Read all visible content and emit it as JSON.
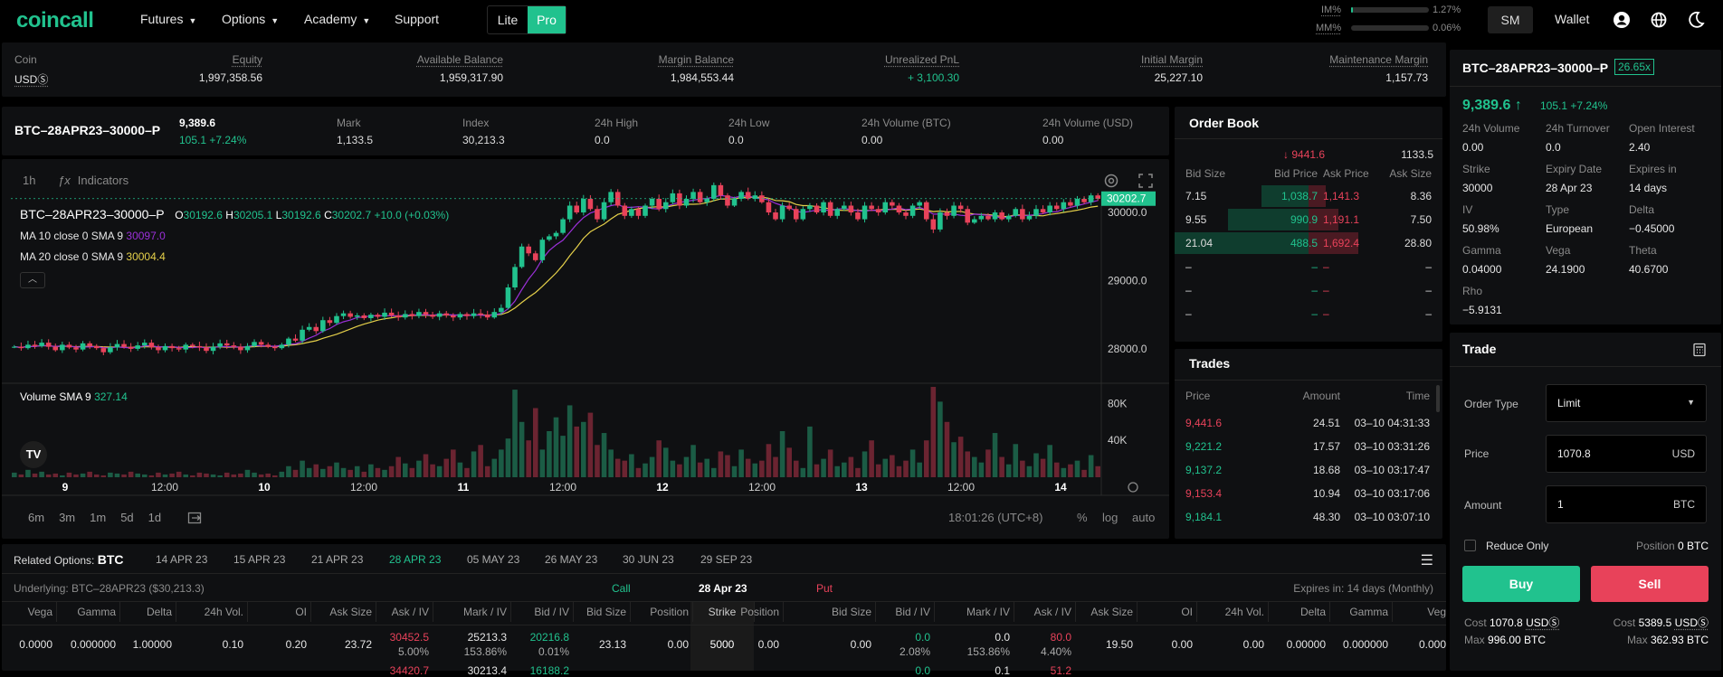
{
  "nav": {
    "logo": "coincall",
    "futures": "Futures",
    "options": "Options",
    "academy": "Academy",
    "support": "Support",
    "lite": "Lite",
    "pro": "Pro",
    "im_label": "IM%",
    "im_value": "1.27%",
    "mm_label": "MM%",
    "mm_value": "0.06%",
    "sm": "SM",
    "wallet": "Wallet"
  },
  "balance": {
    "coin_label": "Coin",
    "coin_value": "USDⓈ",
    "equity_label": "Equity",
    "equity": "1,997,358.56",
    "avail_label": "Available Balance",
    "avail": "1,959,317.90",
    "margin_label": "Margin Balance",
    "margin": "1,984,553.44",
    "upnl_label": "Unrealized PnL",
    "upnl": "+ 3,100.30",
    "im_label": "Initial Margin",
    "im": "25,227.10",
    "mm_label": "Maintenance Margin",
    "mm": "1,157.73"
  },
  "ticker": {
    "symbol": "BTC–28APR23–30000–P",
    "last": "9,389.6",
    "change": "105.1 +7.24%",
    "mark_label": "Mark",
    "mark": "1,133.5",
    "index_label": "Index",
    "index": "30,213.3",
    "high_label": "24h High",
    "high": "0.0",
    "low_label": "24h Low",
    "low": "0.0",
    "volb_label": "24h Volume (BTC)",
    "volb": "0.00",
    "volu_label": "24h Volume (USD)",
    "volu": "0.00"
  },
  "chart": {
    "interval": "1h",
    "indicators": "Indicators",
    "symbol": "BTC–28APR23–30000–P",
    "o": "30192.6",
    "h": "30205.1",
    "l": "30192.6",
    "c": "30202.7",
    "chg": "+10.0 (+0.03%)",
    "ma10": "MA 10 close 0 SMA 9",
    "ma10v": "30097.0",
    "ma20": "MA 20 close 0 SMA 9",
    "ma20v": "30004.4",
    "last_tag": "30202.7",
    "vol_label": "Volume SMA 9",
    "vol_value": "327.14",
    "time": "18:01:26 (UTC+8)",
    "pct": "%",
    "log": "log",
    "auto": "auto",
    "ranges": [
      "6m",
      "3m",
      "1m",
      "5d",
      "1d"
    ],
    "colors": {
      "up": "#21c28e",
      "down": "#e8425a",
      "ma10": "#9b30d9",
      "ma20": "#e5d04a"
    }
  },
  "chart_data": {
    "type": "candlestick",
    "yticks": [
      "30000.0",
      "29000.0",
      "28000.0"
    ],
    "vticks": [
      "80K",
      "40K"
    ],
    "xticks": [
      "9",
      "12:00",
      "10",
      "12:00",
      "11",
      "12:00",
      "12",
      "12:00",
      "13",
      "12:00",
      "14"
    ],
    "closes": [
      28030,
      28010,
      28060,
      28040,
      28090,
      28030,
      27980,
      28060,
      28020,
      27990,
      28080,
      28040,
      28010,
      27950,
      28020,
      28070,
      28030,
      28000,
      28050,
      28090,
      28020,
      27980,
      28040,
      28010,
      27990,
      28060,
      28040,
      28020,
      27970,
      28030,
      28080,
      28050,
      28030,
      27980,
      28040,
      28100,
      28060,
      28030,
      28010,
      28060,
      28150,
      28120,
      28280,
      28320,
      28260,
      28420,
      28380,
      28480,
      28520,
      28470,
      28490,
      28450,
      28500,
      28470,
      28530,
      28490,
      28460,
      28510,
      28480,
      28540,
      28500,
      28470,
      28520,
      28490,
      28460,
      28510,
      28480,
      28520,
      28500,
      28460,
      28540,
      28600,
      28900,
      29200,
      29500,
      29400,
      29300,
      29600,
      29650,
      29700,
      29900,
      30100,
      30000,
      30200,
      30050,
      29900,
      30150,
      30300,
      30100,
      29950,
      30050,
      29950,
      30100,
      30200,
      30050,
      30150,
      30280,
      30100,
      30200,
      30300,
      30150,
      30200,
      30400,
      30250,
      30100,
      30200,
      30300,
      30200,
      30250,
      30150,
      30000,
      29900,
      30100,
      30050,
      29900,
      30050,
      30100,
      30000,
      30150,
      29950,
      30050,
      30100,
      30000,
      29900,
      30100,
      30050,
      30000,
      30150,
      30100,
      30000,
      29950,
      30100,
      30150,
      29900,
      29750,
      30000,
      29950,
      30100,
      30050,
      29850,
      29900,
      29950,
      29900,
      30000,
      29900,
      29950,
      30050,
      29900,
      29950,
      30050,
      30000,
      30100,
      30050,
      30150,
      30100,
      30200,
      30150,
      30250,
      30200
    ],
    "volumes": [
      5,
      3,
      8,
      4,
      6,
      3,
      4,
      2,
      5,
      3,
      4,
      6,
      3,
      2,
      5,
      4,
      3,
      6,
      4,
      3,
      2,
      5,
      3,
      4,
      6,
      3,
      2,
      5,
      4,
      3,
      2,
      5,
      3,
      4,
      8,
      5,
      3,
      4,
      2,
      6,
      12,
      8,
      18,
      10,
      14,
      9,
      12,
      16,
      10,
      8,
      12,
      6,
      14,
      10,
      8,
      12,
      22,
      15,
      10,
      18,
      25,
      14,
      12,
      20,
      30,
      16,
      10,
      28,
      35,
      12,
      20,
      30,
      42,
      95,
      60,
      40,
      75,
      30,
      50,
      65,
      45,
      78,
      55,
      60,
      70,
      35,
      48,
      30,
      20,
      18,
      25,
      10,
      15,
      22,
      40,
      32,
      18,
      14,
      22,
      35,
      16,
      20,
      10,
      28,
      24,
      12,
      30,
      20,
      15,
      18,
      36,
      22,
      50,
      32,
      18,
      10,
      55,
      14,
      20,
      30,
      12,
      16,
      22,
      10,
      28,
      40,
      14,
      20,
      24,
      12,
      18,
      30,
      16,
      40,
      98,
      82,
      60,
      38,
      44,
      28,
      22,
      16,
      30,
      48,
      22,
      14,
      36,
      18,
      12,
      26,
      20,
      35,
      16,
      10,
      14,
      18,
      8,
      24,
      12,
      20,
      30,
      16
    ]
  },
  "orderbook": {
    "title": "Order Book",
    "last": "9441.6",
    "mark": "1133.5",
    "headers": [
      "Bid Size",
      "Bid Price",
      "Ask Price",
      "Ask Size"
    ],
    "rows": [
      {
        "bs": "7.15",
        "bp": "1,038.7",
        "ap": "1,141.3",
        "as": "8.36",
        "bd": 0.35
      },
      {
        "bs": "9.55",
        "bp": "990.9",
        "ap": "1,191.1",
        "as": "7.50",
        "bd": 0.6
      },
      {
        "bs": "21.04",
        "bp": "488.5",
        "ap": "1,692.4",
        "as": "28.80",
        "bd": 1.0
      },
      {
        "bs": "–",
        "bp": "–",
        "ap": "–",
        "as": "–",
        "bd": 0
      },
      {
        "bs": "–",
        "bp": "–",
        "ap": "–",
        "as": "–",
        "bd": 0
      },
      {
        "bs": "–",
        "bp": "–",
        "ap": "–",
        "as": "–",
        "bd": 0
      }
    ]
  },
  "trades": {
    "title": "Trades",
    "headers": [
      "Price",
      "Amount",
      "Time"
    ],
    "rows": [
      {
        "p": "9,441.6",
        "a": "24.51",
        "t": "03–10 04:31:33",
        "side": "sell"
      },
      {
        "p": "9,221.2",
        "a": "17.57",
        "t": "03–10 03:31:26",
        "side": "buy"
      },
      {
        "p": "9,137.2",
        "a": "18.68",
        "t": "03–10 03:17:47",
        "side": "buy"
      },
      {
        "p": "9,153.4",
        "a": "10.94",
        "t": "03–10 03:17:06",
        "side": "sell"
      },
      {
        "p": "9,184.1",
        "a": "48.30",
        "t": "03–10 03:07:10",
        "side": "buy"
      }
    ]
  },
  "info": {
    "symbol": "BTC–28APR23–30000–P",
    "lev": "26.65x",
    "price": "9,389.6",
    "chg": "105.1 +7.24%",
    "cells": [
      {
        "l": "24h Volume",
        "v": "0.00"
      },
      {
        "l": "24h Turnover",
        "v": "0.0"
      },
      {
        "l": "Open Interest",
        "v": "2.40"
      },
      {
        "l": "Strike",
        "v": "30000"
      },
      {
        "l": "Expiry Date",
        "v": "28 Apr 23"
      },
      {
        "l": "Expires in",
        "v": "14 days"
      },
      {
        "l": "IV",
        "v": "50.98%"
      },
      {
        "l": "Type",
        "v": "European"
      },
      {
        "l": "Delta",
        "v": "−0.45000"
      },
      {
        "l": "Gamma",
        "v": "0.04000"
      },
      {
        "l": "Vega",
        "v": "24.1900"
      },
      {
        "l": "Theta",
        "v": "40.6700"
      },
      {
        "l": "Rho",
        "v": "−5.9131"
      }
    ]
  },
  "trade": {
    "title": "Trade",
    "order_type_label": "Order Type",
    "order_type": "Limit",
    "price_label": "Price",
    "price": "1070.8",
    "price_unit": "USD",
    "amount_label": "Amount",
    "amount": "1",
    "amount_unit": "BTC",
    "reduce": "Reduce Only",
    "position": "Position",
    "position_val": "0 BTC",
    "buy": "Buy",
    "sell": "Sell",
    "cost_label": "Cost",
    "buy_cost": "1070.8",
    "sell_cost": "5389.5",
    "cost_unit": "USDⓈ",
    "max_label": "Max",
    "buy_max": "996.00 BTC",
    "sell_max": "362.93 BTC"
  },
  "options": {
    "related": "Related Options:",
    "asset": "BTC",
    "dates": [
      "14 APR 23",
      "15 APR 23",
      "21 APR 23",
      "28 APR 23",
      "05 MAY 23",
      "26 MAY 23",
      "30 JUN 23",
      "29 SEP 23"
    ],
    "active": 3,
    "underlying": "Underlying: BTC–28APR23 ($30,213.3)",
    "call": "Call",
    "date": "28 Apr 23",
    "put": "Put",
    "expires": "Expires in: 14 days (Monthly)",
    "headers": [
      "Vega",
      "Gamma",
      "Delta",
      "24h Vol.",
      "OI",
      "Ask Size",
      "Ask / IV",
      "Mark / IV",
      "Bid / IV",
      "Bid Size",
      "Position",
      "Strike",
      "Position",
      "Bid Size",
      "Bid / IV",
      "Mark / IV",
      "Ask / IV",
      "Ask Size",
      "OI",
      "24h Vol.",
      "Delta",
      "Gamma",
      "Veg"
    ],
    "row1": {
      "vega": "0.0000",
      "gamma": "0.000000",
      "delta": "1.00000",
      "vol": "0.10",
      "oi": "0.20",
      "asks": "23.72",
      "ask": "30452.5",
      "askiv": "5.00%",
      "mark": "25213.3",
      "markiv": "153.86%",
      "bid": "20216.8",
      "bidiv": "0.01%",
      "bids": "23.13",
      "pos": "0.00",
      "strike": "5000",
      "ppos": "0.00",
      "pbids": "0.00",
      "pbid": "0.0",
      "pbidiv": "2.08%",
      "pmark": "0.0",
      "pmarkiv": "153.86%",
      "pask": "80.0",
      "paskiv": "4.40%",
      "pasks": "19.50",
      "poi": "0.00",
      "pvol": "0.00",
      "pdelta": "0.00000",
      "pgamma": "0.000000",
      "pvega": "0.000"
    },
    "row2": {
      "ask": "34420.7",
      "mark": "30213.4",
      "bid": "16188.2",
      "pbid": "0.0",
      "pmark": "0.1",
      "pask": "51.2"
    }
  }
}
